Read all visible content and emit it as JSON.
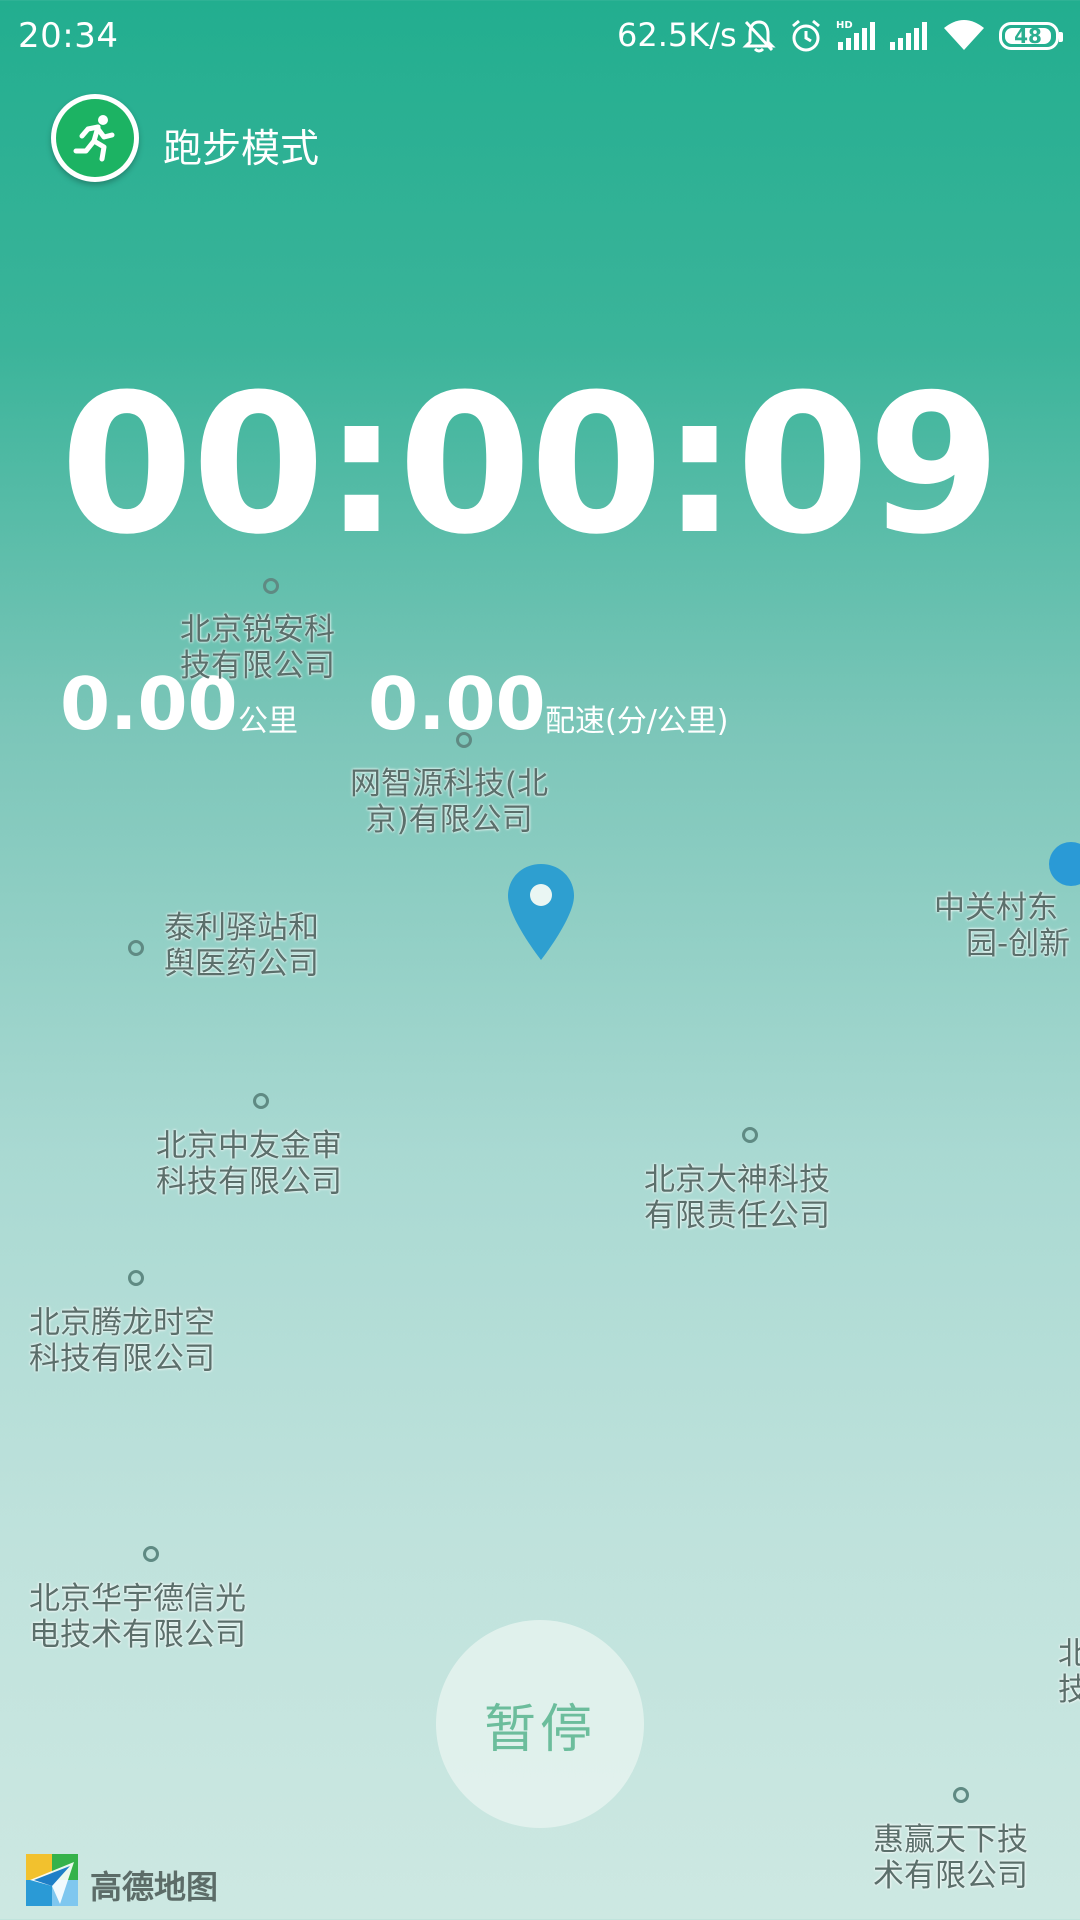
{
  "status_bar": {
    "time": "20:34",
    "net_speed": "62.5K/s",
    "icons": [
      "mute-bell-icon",
      "alarm-icon",
      "hd-signal-icon",
      "signal-icon",
      "wifi-icon"
    ],
    "battery": "48"
  },
  "header": {
    "mode_icon": "running-person-icon",
    "title": "跑步模式"
  },
  "timer": "00:00:09",
  "stats": {
    "distance_value": "0.00",
    "distance_unit": "公里",
    "pace_value": "0.00",
    "pace_unit": "配速(分/公里)"
  },
  "map": {
    "pois": [
      {
        "line1": "北京锐安科",
        "line2": "技有限公司"
      },
      {
        "line1": "网智源科技(北",
        "line2": "京)有限公司"
      },
      {
        "line1": "泰利驿站和",
        "line2": "舆医药公司"
      },
      {
        "line1": "中关村东",
        "line2": "园-创新"
      },
      {
        "line1": "北京中友金审",
        "line2": "科技有限公司"
      },
      {
        "line1": "北京大神科技",
        "line2": "有限责任公司"
      },
      {
        "line1": "北京腾龙时空",
        "line2": "科技有限公司"
      },
      {
        "line1": "北京华宇德信光",
        "line2": "电技术有限公司"
      },
      {
        "line1": "北",
        "line2": "技"
      },
      {
        "line1": "惠赢天下技",
        "line2": "术有限公司"
      }
    ],
    "marker_color": "#2e9fd0",
    "provider_logo_text": "高德地图"
  },
  "controls": {
    "pause_label": "暂停"
  },
  "colors": {
    "header_gradient_top": "#22ae8f",
    "mode_icon_green": "#1cb363",
    "pause_text": "#6cbd9c"
  }
}
